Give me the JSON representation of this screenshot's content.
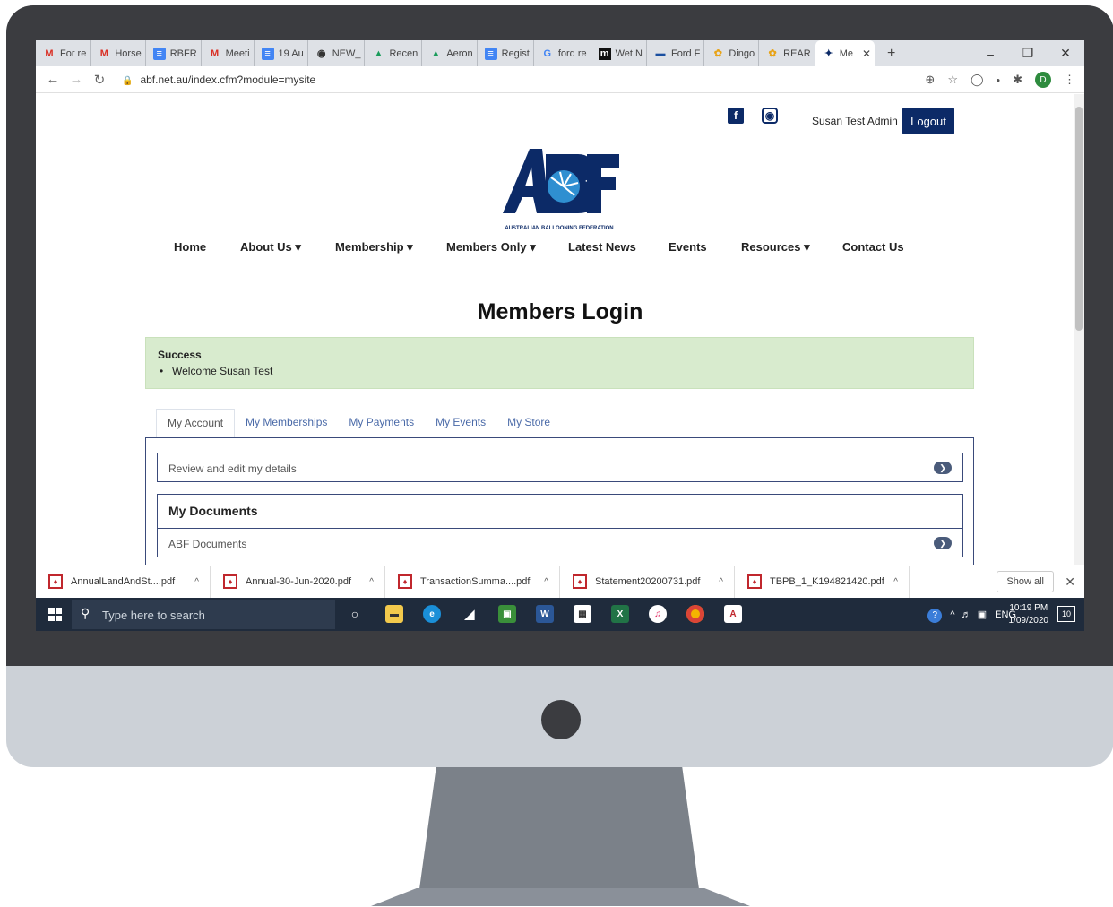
{
  "browser": {
    "tabs": [
      {
        "icon": "gmail-icon",
        "label": "For re"
      },
      {
        "icon": "gmail-icon",
        "label": "Horse"
      },
      {
        "icon": "docs-icon",
        "label": "RBFR"
      },
      {
        "icon": "gmail-icon",
        "label": "Meeti"
      },
      {
        "icon": "docs-icon",
        "label": "19 Au"
      },
      {
        "icon": "globe-icon",
        "label": "NEW_"
      },
      {
        "icon": "drive-icon",
        "label": "Recen"
      },
      {
        "icon": "drive-icon",
        "label": "Aeron"
      },
      {
        "icon": "docs-icon",
        "label": "Regist"
      },
      {
        "icon": "google-icon",
        "label": "ford re"
      },
      {
        "icon": "site-icon",
        "label": "Wet N"
      },
      {
        "icon": "site-icon",
        "label": "Ford F"
      },
      {
        "icon": "paw-icon",
        "label": "Dingo"
      },
      {
        "icon": "paw-icon",
        "label": "REAR"
      },
      {
        "icon": "abf-icon",
        "label": "Me"
      }
    ],
    "url": "abf.net.au/index.cfm?module=mysite",
    "profile_initial": "D"
  },
  "site": {
    "user_name": "Susan Test Admin",
    "logout_label": "Logout",
    "logo_subtitle": "AUSTRALIAN BALLOONING FEDERATION",
    "nav": [
      "Home",
      "About Us ▾",
      "Membership ▾",
      "Members Only ▾",
      "Latest News",
      "Events",
      "Resources ▾",
      "Contact Us"
    ],
    "page_title": "Members Login",
    "alert_title": "Success",
    "alert_message": "Welcome Susan Test",
    "tabs": [
      "My Account",
      "My Memberships",
      "My Payments",
      "My Events",
      "My Store"
    ],
    "review_label": "Review and edit my details",
    "documents_heading": "My Documents",
    "abf_documents_label": "ABF Documents"
  },
  "downloads": {
    "files": [
      "AnnualLandAndSt....pdf",
      "Annual-30-Jun-2020.pdf",
      "TransactionSumma....pdf",
      "Statement20200731.pdf",
      "TBPB_1_K194821420.pdf"
    ],
    "show_all": "Show all"
  },
  "taskbar": {
    "search_placeholder": "Type here to search",
    "language": "ENG",
    "time": "10:19 PM",
    "date": "1/09/2020",
    "notifications": "10"
  }
}
